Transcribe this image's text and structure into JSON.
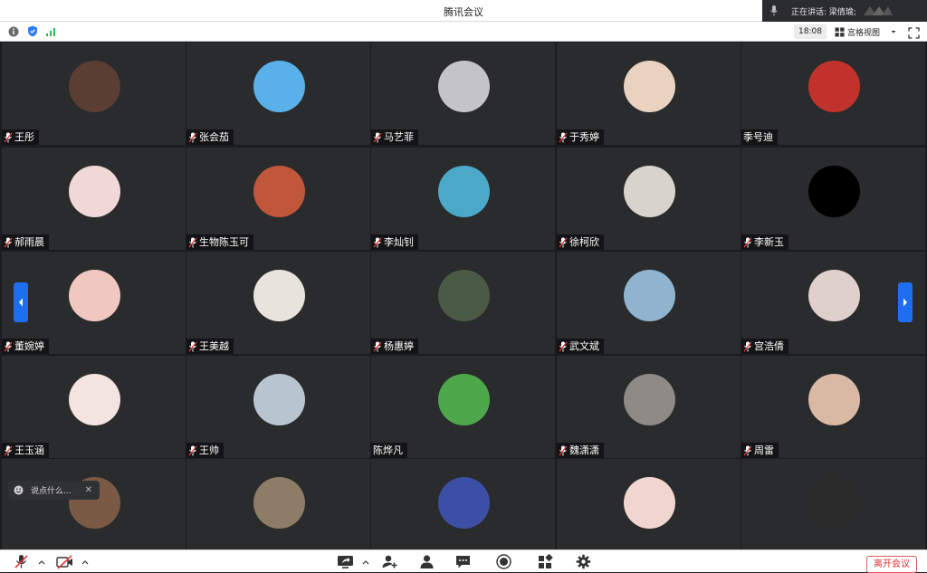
{
  "window": {
    "title": "腾讯会议"
  },
  "speaking": {
    "label": "正在讲话: 梁倩瑜;"
  },
  "toolbar": {
    "time": "18:08",
    "view_label": "宫格视图"
  },
  "participants": [
    {
      "name": "王彤",
      "muted": true,
      "avatar_color": "#5a3d33"
    },
    {
      "name": "张会茄",
      "muted": true,
      "avatar_color": "#5ab0e8"
    },
    {
      "name": "马艺菲",
      "muted": true,
      "avatar_color": "#c4c4c8"
    },
    {
      "name": "于秀婷",
      "muted": true,
      "avatar_color": "#e9d2c0"
    },
    {
      "name": "季号迪",
      "muted": false,
      "avatar_color": "#c2322c"
    },
    {
      "name": "郝雨晨",
      "muted": true,
      "avatar_color": "#efd8d6"
    },
    {
      "name": "生物陈玉可",
      "muted": true,
      "avatar_color": "#c0563a"
    },
    {
      "name": "李灿钊",
      "muted": true,
      "avatar_color": "#4aa9c8"
    },
    {
      "name": "徐柯欣",
      "muted": true,
      "avatar_color": "#d8d3cc"
    },
    {
      "name": "李新玉",
      "muted": true,
      "avatar_color": "#000000"
    },
    {
      "name": "董婉婷",
      "muted": true,
      "avatar_color": "#f0c8c0"
    },
    {
      "name": "王美越",
      "muted": true,
      "avatar_color": "#e9e3de"
    },
    {
      "name": "杨惠婷",
      "muted": true,
      "avatar_color": "#4a5a45"
    },
    {
      "name": "武文斌",
      "muted": true,
      "avatar_color": "#90b4cf"
    },
    {
      "name": "宫浩倩",
      "muted": true,
      "avatar_color": "#e0d0cc"
    },
    {
      "name": "王玉涵",
      "muted": true,
      "avatar_color": "#f4e4df"
    },
    {
      "name": "王帅",
      "muted": true,
      "avatar_color": "#b8c4cf"
    },
    {
      "name": "陈烨凡",
      "muted": false,
      "avatar_color": "#4ea84b"
    },
    {
      "name": "魏潇潇",
      "muted": true,
      "avatar_color": "#8e8a86"
    },
    {
      "name": "周雷",
      "muted": true,
      "avatar_color": "#d9b9a4"
    },
    {
      "name": "",
      "muted": false,
      "avatar_color": "#7a5a44"
    },
    {
      "name": "",
      "muted": false,
      "avatar_color": "#8d7c66"
    },
    {
      "name": "",
      "muted": false,
      "avatar_color": "#3d4fa4"
    },
    {
      "name": "",
      "muted": false,
      "avatar_color": "#f1d6cf"
    },
    {
      "name": "",
      "muted": false,
      "avatar_color": "#2b2b2b"
    }
  ],
  "chat": {
    "placeholder": "说点什么..."
  },
  "bottombar": {
    "leave_label": "离开会议"
  },
  "colors": {
    "accent": "#1e6ff0",
    "muted_mic": "#e03a3a",
    "leave": "#d83232"
  }
}
